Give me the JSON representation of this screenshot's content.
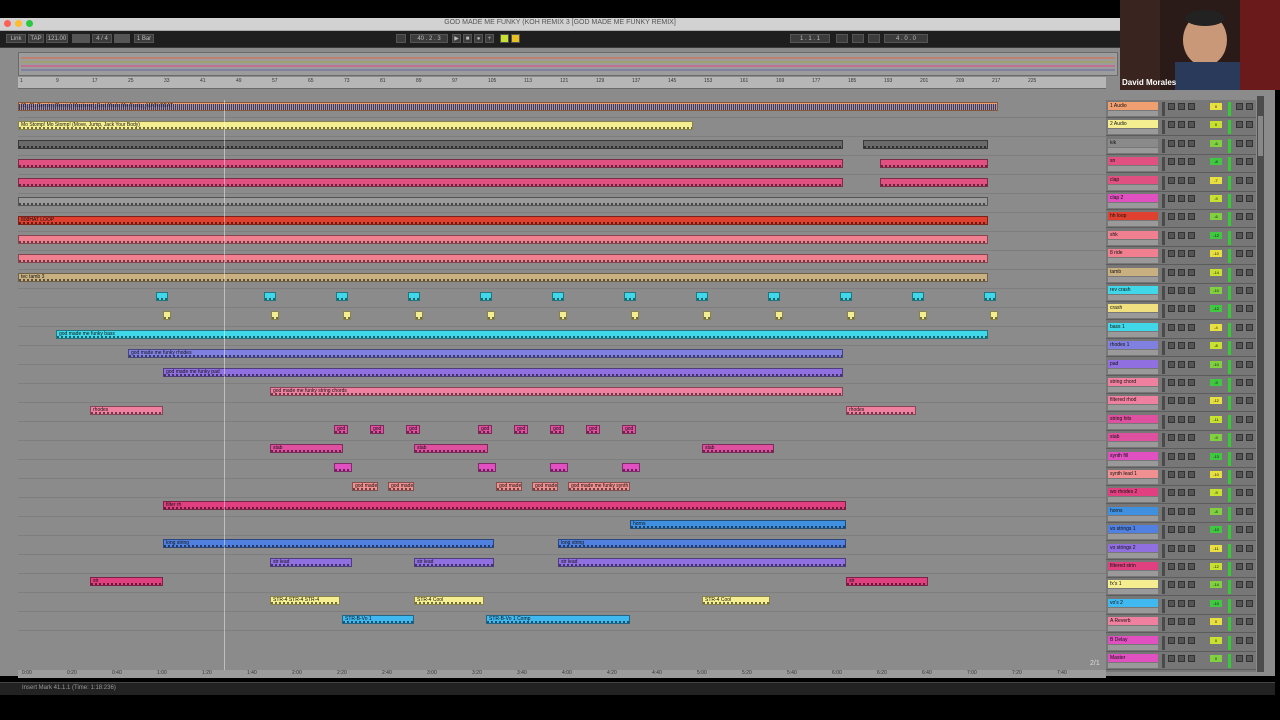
{
  "window": {
    "title": "GOD MADE ME FUNKY (KOH REMIX 3 [GOD MADE ME FUNKY REMIX]"
  },
  "webcam": {
    "name": "David Morales"
  },
  "control_bar": {
    "link": "Link",
    "tap": "TAP",
    "tempo": "121.00",
    "sig": "4 / 4",
    "bar": "1 Bar",
    "pos": "40 . 2 . 3",
    "loop_start": "1 . 1 . 1",
    "loop_len": "4 . 0 . 0"
  },
  "ruler_marks": [
    "1",
    "9",
    "17",
    "25",
    "33",
    "41",
    "49",
    "57",
    "65",
    "73",
    "81",
    "89",
    "97",
    "105",
    "113",
    "121",
    "129",
    "137",
    "145",
    "153",
    "161",
    "169",
    "177",
    "185",
    "193",
    "201",
    "209",
    "217",
    "225"
  ],
  "time_marks": [
    "0:00",
    "0:20",
    "0:40",
    "1:00",
    "1:20",
    "1:40",
    "2:00",
    "2:20",
    "2:40",
    "3:00",
    "3:20",
    "3:40",
    "4:00",
    "4:20",
    "4:40",
    "5:00",
    "5:20",
    "5:40",
    "6:00",
    "6:20",
    "6:40",
    "7:00",
    "7:20",
    "7:40"
  ],
  "status": {
    "text": "Insert Mark 41.1.1 (Time: 1:18:236)"
  },
  "page_indicator": "2/1",
  "tracks": [
    {
      "name": "1 Audio",
      "color": "#f0a070",
      "vol": "0"
    },
    {
      "name": "2 Audio",
      "color": "#f5ee90",
      "vol": "0"
    },
    {
      "name": "kik",
      "color": "#8a8a8a",
      "vol": "-6"
    },
    {
      "name": "sn",
      "color": "#e05080",
      "vol": "-8"
    },
    {
      "name": "clap",
      "color": "#e05080",
      "vol": "-7"
    },
    {
      "name": "clap 2",
      "color": "#e050c0",
      "vol": "-9"
    },
    {
      "name": "hh loop",
      "color": "#e04030",
      "vol": "-6"
    },
    {
      "name": "shk",
      "color": "#f08090",
      "vol": "-12"
    },
    {
      "name": "8 ride",
      "color": "#f08090",
      "vol": "-10"
    },
    {
      "name": "tamb",
      "color": "#c8b080",
      "vol": "-14"
    },
    {
      "name": "rev crash",
      "color": "#40d8e8",
      "vol": "-10"
    },
    {
      "name": "crash",
      "color": "#f0e080",
      "vol": "-12"
    },
    {
      "name": "bass 1",
      "color": "#40d8e8",
      "vol": "-4"
    },
    {
      "name": "rhodes 1",
      "color": "#8080e0",
      "vol": "-8"
    },
    {
      "name": "pad",
      "color": "#9070e0",
      "vol": "-10"
    },
    {
      "name": "string chord",
      "color": "#f080a0",
      "vol": "-9"
    },
    {
      "name": "filtered rhod",
      "color": "#f080a0",
      "vol": "-12"
    },
    {
      "name": "string hits",
      "color": "#e050a0",
      "vol": "-11"
    },
    {
      "name": "stab",
      "color": "#e050a0",
      "vol": "-9"
    },
    {
      "name": "synth fill",
      "color": "#e050c0",
      "vol": "-13"
    },
    {
      "name": "synth lead 1",
      "color": "#f09090",
      "vol": "-10"
    },
    {
      "name": "wo rhodes 2",
      "color": "#e04080",
      "vol": "-9"
    },
    {
      "name": "horns",
      "color": "#4090e0",
      "vol": "-8"
    },
    {
      "name": "vo strings 1",
      "color": "#5080e0",
      "vol": "-10"
    },
    {
      "name": "vo strings 2",
      "color": "#9070e0",
      "vol": "-11"
    },
    {
      "name": "filtered strin",
      "color": "#e04080",
      "vol": "-12"
    },
    {
      "name": "fx's 1",
      "color": "#f5ee90",
      "vol": "-14"
    },
    {
      "name": "vo's 2",
      "color": "#40b8f0",
      "vol": "-10"
    },
    {
      "name": "A Reverb",
      "color": "#f080a0",
      "vol": "0"
    },
    {
      "name": "B Delay",
      "color": "#e050c0",
      "vol": "0"
    },
    {
      "name": "Master",
      "color": "#e050c0",
      "vol": "0"
    }
  ],
  "clips": [
    {
      "lane": 0,
      "start": 0,
      "end": 980,
      "color": "#f0a070",
      "label": "05_CL Gemini (Remix) Mastered_God Made Me Funky_MAIN-BEAT",
      "wave": true
    },
    {
      "lane": 1,
      "start": 0,
      "end": 675,
      "color": "#f5ee90",
      "label": "Mo Stomp! Mo Stomp! (Move, Jump, Jack Your Body)",
      "wave": false
    },
    {
      "lane": 2,
      "start": 0,
      "end": 825,
      "color": "#6a6a6a",
      "label": "",
      "wave": false
    },
    {
      "lane": 2,
      "start": 845,
      "end": 970,
      "color": "#6a6a6a",
      "label": "",
      "wave": false
    },
    {
      "lane": 3,
      "start": 0,
      "end": 825,
      "color": "#e05080",
      "label": "",
      "wave": false
    },
    {
      "lane": 3,
      "start": 862,
      "end": 970,
      "color": "#e05080",
      "label": "",
      "wave": false
    },
    {
      "lane": 4,
      "start": 0,
      "end": 825,
      "color": "#e05080",
      "label": "",
      "wave": false
    },
    {
      "lane": 4,
      "start": 862,
      "end": 970,
      "color": "#e05080",
      "label": "",
      "wave": false
    },
    {
      "lane": 5,
      "start": 0,
      "end": 970,
      "color": "#9a9a9a",
      "label": "",
      "wave": false
    },
    {
      "lane": 6,
      "start": 0,
      "end": 970,
      "color": "#e04030",
      "label": "808HAT LOOP",
      "wave": false
    },
    {
      "lane": 7,
      "start": 0,
      "end": 970,
      "color": "#f08090",
      "label": "",
      "wave": false
    },
    {
      "lane": 8,
      "start": 0,
      "end": 970,
      "color": "#f08090",
      "label": "",
      "wave": false
    },
    {
      "lane": 9,
      "start": 0,
      "end": 970,
      "color": "#c8b080",
      "label": "tec tamb 3",
      "wave": false
    },
    {
      "lane": 10,
      "start": 138,
      "end": 150,
      "color": "#40d8e8",
      "label": "",
      "wave": false
    },
    {
      "lane": 10,
      "start": 246,
      "end": 258,
      "color": "#40d8e8",
      "label": "",
      "wave": false
    },
    {
      "lane": 10,
      "start": 318,
      "end": 330,
      "color": "#40d8e8",
      "label": "",
      "wave": false
    },
    {
      "lane": 10,
      "start": 390,
      "end": 402,
      "color": "#40d8e8",
      "label": "",
      "wave": false
    },
    {
      "lane": 10,
      "start": 462,
      "end": 474,
      "color": "#40d8e8",
      "label": "",
      "wave": false
    },
    {
      "lane": 10,
      "start": 534,
      "end": 546,
      "color": "#40d8e8",
      "label": "",
      "wave": false
    },
    {
      "lane": 10,
      "start": 606,
      "end": 618,
      "color": "#40d8e8",
      "label": "",
      "wave": false
    },
    {
      "lane": 10,
      "start": 678,
      "end": 690,
      "color": "#40d8e8",
      "label": "",
      "wave": false
    },
    {
      "lane": 10,
      "start": 750,
      "end": 762,
      "color": "#40d8e8",
      "label": "",
      "wave": false
    },
    {
      "lane": 10,
      "start": 822,
      "end": 834,
      "color": "#40d8e8",
      "label": "",
      "wave": false
    },
    {
      "lane": 10,
      "start": 894,
      "end": 906,
      "color": "#40d8e8",
      "label": "",
      "wave": false
    },
    {
      "lane": 10,
      "start": 966,
      "end": 978,
      "color": "#40d8e8",
      "label": "",
      "wave": false
    },
    {
      "lane": 11,
      "start": 145,
      "end": 153,
      "color": "#f5ee90",
      "label": "",
      "wave": false
    },
    {
      "lane": 11,
      "start": 253,
      "end": 261,
      "color": "#f5ee90",
      "label": "",
      "wave": false
    },
    {
      "lane": 11,
      "start": 325,
      "end": 333,
      "color": "#f5ee90",
      "label": "",
      "wave": false
    },
    {
      "lane": 11,
      "start": 397,
      "end": 405,
      "color": "#f5ee90",
      "label": "",
      "wave": false
    },
    {
      "lane": 11,
      "start": 469,
      "end": 477,
      "color": "#f5ee90",
      "label": "",
      "wave": false
    },
    {
      "lane": 11,
      "start": 541,
      "end": 549,
      "color": "#f5ee90",
      "label": "",
      "wave": false
    },
    {
      "lane": 11,
      "start": 613,
      "end": 621,
      "color": "#f5ee90",
      "label": "",
      "wave": false
    },
    {
      "lane": 11,
      "start": 685,
      "end": 693,
      "color": "#f5ee90",
      "label": "",
      "wave": false
    },
    {
      "lane": 11,
      "start": 757,
      "end": 765,
      "color": "#f5ee90",
      "label": "",
      "wave": false
    },
    {
      "lane": 11,
      "start": 829,
      "end": 837,
      "color": "#f5ee90",
      "label": "",
      "wave": false
    },
    {
      "lane": 11,
      "start": 901,
      "end": 909,
      "color": "#f5ee90",
      "label": "",
      "wave": false
    },
    {
      "lane": 11,
      "start": 972,
      "end": 980,
      "color": "#f5ee90",
      "label": "",
      "wave": false
    },
    {
      "lane": 12,
      "start": 38,
      "end": 970,
      "color": "#40d8e8",
      "label": "god made me funky bass",
      "wave": false
    },
    {
      "lane": 13,
      "start": 110,
      "end": 825,
      "color": "#8080e0",
      "label": "god made me funky rhodes",
      "wave": false
    },
    {
      "lane": 14,
      "start": 145,
      "end": 825,
      "color": "#9070e0",
      "label": "god made me funky pad",
      "wave": false
    },
    {
      "lane": 15,
      "start": 252,
      "end": 825,
      "color": "#f080a0",
      "label": "god made me funky string chords",
      "wave": false
    },
    {
      "lane": 16,
      "start": 72,
      "end": 145,
      "color": "#f080a0",
      "label": "rhodes",
      "wave": false
    },
    {
      "lane": 16,
      "start": 828,
      "end": 898,
      "color": "#f080a0",
      "label": "rhodes",
      "wave": false
    },
    {
      "lane": 17,
      "start": 316,
      "end": 330,
      "color": "#e050a0",
      "label": "god",
      "wave": false
    },
    {
      "lane": 17,
      "start": 352,
      "end": 366,
      "color": "#e050a0",
      "label": "god",
      "wave": false
    },
    {
      "lane": 17,
      "start": 388,
      "end": 402,
      "color": "#e050a0",
      "label": "god",
      "wave": false
    },
    {
      "lane": 17,
      "start": 460,
      "end": 474,
      "color": "#e050a0",
      "label": "god",
      "wave": false
    },
    {
      "lane": 17,
      "start": 496,
      "end": 510,
      "color": "#e050a0",
      "label": "god",
      "wave": false
    },
    {
      "lane": 17,
      "start": 532,
      "end": 546,
      "color": "#e050a0",
      "label": "god",
      "wave": false
    },
    {
      "lane": 17,
      "start": 568,
      "end": 582,
      "color": "#e050a0",
      "label": "god",
      "wave": false
    },
    {
      "lane": 17,
      "start": 604,
      "end": 618,
      "color": "#e050a0",
      "label": "god",
      "wave": false
    },
    {
      "lane": 18,
      "start": 252,
      "end": 325,
      "color": "#e050a0",
      "label": "stab",
      "wave": false
    },
    {
      "lane": 18,
      "start": 396,
      "end": 470,
      "color": "#e050a0",
      "label": "stab",
      "wave": false
    },
    {
      "lane": 18,
      "start": 684,
      "end": 756,
      "color": "#e050a0",
      "label": "stab",
      "wave": false
    },
    {
      "lane": 19,
      "start": 316,
      "end": 334,
      "color": "#e050c0",
      "label": "",
      "wave": false
    },
    {
      "lane": 19,
      "start": 460,
      "end": 478,
      "color": "#e050c0",
      "label": "",
      "wave": false
    },
    {
      "lane": 19,
      "start": 532,
      "end": 550,
      "color": "#e050c0",
      "label": "",
      "wave": false
    },
    {
      "lane": 19,
      "start": 604,
      "end": 622,
      "color": "#e050c0",
      "label": "",
      "wave": false
    },
    {
      "lane": 20,
      "start": 334,
      "end": 360,
      "color": "#f09090",
      "label": "god made",
      "wave": false
    },
    {
      "lane": 20,
      "start": 370,
      "end": 396,
      "color": "#f09090",
      "label": "god made",
      "wave": false
    },
    {
      "lane": 20,
      "start": 478,
      "end": 504,
      "color": "#f09090",
      "label": "god made",
      "wave": false
    },
    {
      "lane": 20,
      "start": 514,
      "end": 540,
      "color": "#f09090",
      "label": "god made",
      "wave": false
    },
    {
      "lane": 20,
      "start": 550,
      "end": 612,
      "color": "#f09090",
      "label": "god made me funky synth",
      "wave": false
    },
    {
      "lane": 21,
      "start": 145,
      "end": 828,
      "color": "#e04080",
      "label": "filter rh",
      "wave": false
    },
    {
      "lane": 22,
      "start": 612,
      "end": 828,
      "color": "#4090e0",
      "label": "horns",
      "wave": false
    },
    {
      "lane": 23,
      "start": 145,
      "end": 476,
      "color": "#5080e0",
      "label": "long string",
      "wave": false
    },
    {
      "lane": 23,
      "start": 540,
      "end": 828,
      "color": "#5080e0",
      "label": "long string",
      "wave": false
    },
    {
      "lane": 24,
      "start": 252,
      "end": 334,
      "color": "#9070e0",
      "label": "str lead",
      "wave": false
    },
    {
      "lane": 24,
      "start": 396,
      "end": 476,
      "color": "#9070e0",
      "label": "str lead",
      "wave": false
    },
    {
      "lane": 24,
      "start": 540,
      "end": 828,
      "color": "#9070e0",
      "label": "str lead",
      "wave": false
    },
    {
      "lane": 25,
      "start": 72,
      "end": 145,
      "color": "#e04080",
      "label": "str",
      "wave": false
    },
    {
      "lane": 25,
      "start": 828,
      "end": 910,
      "color": "#e04080",
      "label": "str",
      "wave": false
    },
    {
      "lane": 26,
      "start": 252,
      "end": 322,
      "color": "#f5ee90",
      "label": "STR-4 STR-4 STR-4",
      "wave": false
    },
    {
      "lane": 26,
      "start": 396,
      "end": 466,
      "color": "#f5ee90",
      "label": "STR-4 Cool",
      "wave": false
    },
    {
      "lane": 26,
      "start": 684,
      "end": 752,
      "color": "#f5ee90",
      "label": "STR-4 Cool",
      "wave": false
    },
    {
      "lane": 27,
      "start": 324,
      "end": 396,
      "color": "#40b8f0",
      "label": "STR-B-Vo 1",
      "wave": false
    },
    {
      "lane": 27,
      "start": 468,
      "end": 612,
      "color": "#40b8f0",
      "label": "STR-B-Vo 1 Comp",
      "wave": false
    }
  ]
}
